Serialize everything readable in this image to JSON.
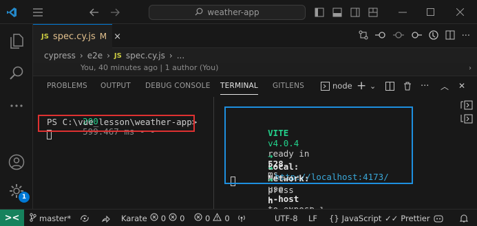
{
  "titlebar": {
    "search_text": "weather-app",
    "icons": [
      "vscode-logo-icon",
      "menu-icon",
      "back-arrow-icon",
      "forward-arrow-icon",
      "search-icon",
      "toggle-sidebar-icon",
      "toggle-panel-icon",
      "toggle-secondary-sidebar-icon",
      "customize-layout-icon",
      "minimize-icon",
      "maximize-icon",
      "close-icon"
    ]
  },
  "activitybar": {
    "icons": [
      "explorer-icon",
      "search-icon",
      "more-icon",
      "account-icon",
      "settings-gear-icon"
    ],
    "settings_badge": "1"
  },
  "editor": {
    "tab": {
      "lang": "JS",
      "name": "spec.cy.js",
      "modified": "M",
      "close": "×"
    },
    "breadcrumb": [
      "cypress",
      "e2e",
      "spec.cy.js",
      "..."
    ],
    "breadcrumb_lang": "JS",
    "codelens": "You, 40 minutes ago | 1 author (You)",
    "actions": [
      "open-changes-icon",
      "go-back-icon",
      "circle-icon",
      "go-forward-icon",
      "timeline-icon",
      "split-editor-icon",
      "more-actions-icon"
    ]
  },
  "panel": {
    "tabs": [
      "PROBLEMS",
      "OUTPUT",
      "DEBUG CONSOLE",
      "TERMINAL",
      "GITLENS"
    ],
    "active_tab": "TERMINAL",
    "terminal_name": "node",
    "actions": {
      "add": "+",
      "dropdown": "⌄",
      "more": "···",
      "collapse": "︿",
      "close": "✕"
    }
  },
  "terminal_left": {
    "partial_line": "200 599.467 ms - -",
    "prompt": "PS C:\\vue_lesson\\weather-app>"
  },
  "terminal_right": {
    "vite": "VITE",
    "version": "v4.0.4",
    "ready": "ready in",
    "ready_ms": "528",
    "ms_unit": "ms",
    "arrow": "➜",
    "local_label": "Local:",
    "local_url": "http://localhost:4173/",
    "network_label": "Network:",
    "network_text_1": "use",
    "network_flag": "--host",
    "network_text_2": "to expose",
    "help_text_1": "press",
    "help_key": "h",
    "help_text_2": "to show help"
  },
  "statusbar": {
    "remote": "><",
    "branch": "master*",
    "karate": "Karate",
    "karate_errors": "0",
    "karate_warnings": "0",
    "problems_errors": "0",
    "problems_warnings": "0",
    "encoding": "UTF-8",
    "eol": "LF",
    "language": "JavaScript",
    "prettier": "Prettier"
  },
  "colors": {
    "accent": "#0078d4",
    "remote_bg": "#16825d",
    "highlight_red": "#e03131",
    "highlight_blue": "#1e90e0",
    "vite_green": "#23d18b",
    "modified": "#e2c08d"
  }
}
